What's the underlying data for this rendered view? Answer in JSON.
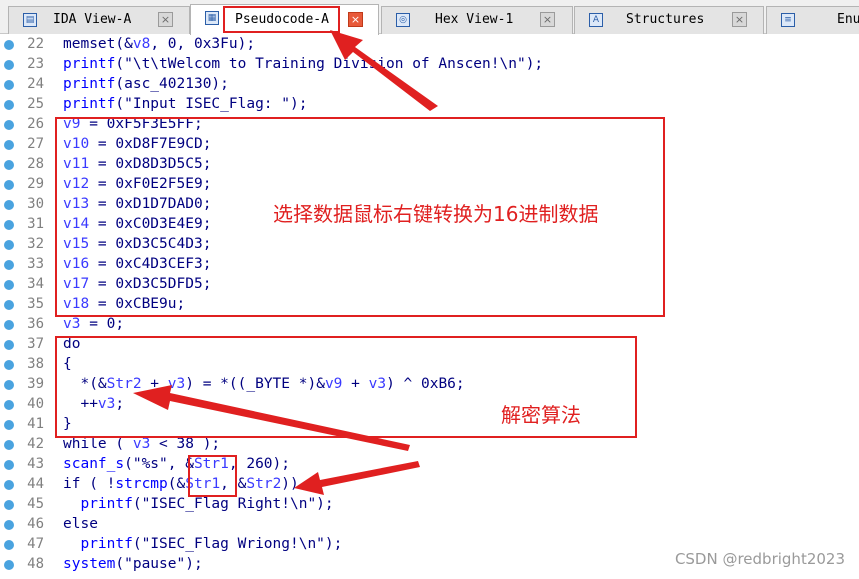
{
  "tabs": [
    {
      "label": "IDA View-A",
      "icon": "ida-view-icon",
      "active": false
    },
    {
      "label": "Pseudocode-A",
      "icon": "pseudocode-icon",
      "active": true
    },
    {
      "label": "Hex View-1",
      "icon": "hex-view-icon",
      "active": false
    },
    {
      "label": "Structures",
      "icon": "structures-icon",
      "active": false
    },
    {
      "label": "Enu",
      "icon": "enums-icon",
      "active": false
    }
  ],
  "code": [
    {
      "n": "22",
      "segs": [
        [
          "",
          "memset(&"
        ],
        [
          "var",
          "v8"
        ],
        [
          "",
          ", 0, 0x3Fu);"
        ]
      ]
    },
    {
      "n": "23",
      "segs": [
        [
          "fn",
          "printf"
        ],
        [
          "",
          "(\"\\t\\tWelcom to Training Division of Anscen!\\n\");"
        ]
      ]
    },
    {
      "n": "24",
      "segs": [
        [
          "fn",
          "printf"
        ],
        [
          "",
          "(asc_402130);"
        ]
      ]
    },
    {
      "n": "25",
      "segs": [
        [
          "fn",
          "printf"
        ],
        [
          "",
          "(\"Input ISEC_Flag: \");"
        ]
      ]
    },
    {
      "n": "26",
      "segs": [
        [
          "var",
          "v9"
        ],
        [
          "",
          " = 0xF5F3E5FF;"
        ]
      ]
    },
    {
      "n": "27",
      "segs": [
        [
          "var",
          "v10"
        ],
        [
          "",
          " = 0xD8F7E9CD;"
        ]
      ]
    },
    {
      "n": "28",
      "segs": [
        [
          "var",
          "v11"
        ],
        [
          "",
          " = 0xD8D3D5C5;"
        ]
      ]
    },
    {
      "n": "29",
      "segs": [
        [
          "var",
          "v12"
        ],
        [
          "",
          " = 0xF0E2F5E9;"
        ]
      ]
    },
    {
      "n": "30",
      "segs": [
        [
          "var",
          "v13"
        ],
        [
          "",
          " = 0xD1D7DAD0;"
        ]
      ]
    },
    {
      "n": "31",
      "segs": [
        [
          "var",
          "v14"
        ],
        [
          "",
          " = 0xC0D3E4E9;"
        ]
      ]
    },
    {
      "n": "32",
      "segs": [
        [
          "var",
          "v15"
        ],
        [
          "",
          " = 0xD3C5C4D3;"
        ]
      ]
    },
    {
      "n": "33",
      "segs": [
        [
          "var",
          "v16"
        ],
        [
          "",
          " = 0xC4D3CEF3;"
        ]
      ]
    },
    {
      "n": "34",
      "segs": [
        [
          "var",
          "v17"
        ],
        [
          "",
          " = 0xD3C5DFD5;"
        ]
      ]
    },
    {
      "n": "35",
      "segs": [
        [
          "var",
          "v18"
        ],
        [
          "",
          " = 0xCBE9u;"
        ]
      ]
    },
    {
      "n": "36",
      "segs": [
        [
          "var",
          "v3"
        ],
        [
          "",
          " = 0;"
        ]
      ]
    },
    {
      "n": "37",
      "segs": [
        [
          "",
          "do"
        ]
      ]
    },
    {
      "n": "38",
      "segs": [
        [
          "",
          "{"
        ]
      ]
    },
    {
      "n": "39",
      "segs": [
        [
          "",
          "  *(&"
        ],
        [
          "var",
          "Str2"
        ],
        [
          "",
          " + "
        ],
        [
          "var",
          "v3"
        ],
        [
          "",
          ") = *((_BYTE *)&"
        ],
        [
          "var",
          "v9"
        ],
        [
          "",
          " + "
        ],
        [
          "var",
          "v3"
        ],
        [
          "",
          ") ^ 0xB6;"
        ]
      ]
    },
    {
      "n": "40",
      "segs": [
        [
          "",
          "  ++"
        ],
        [
          "var",
          "v3"
        ],
        [
          "",
          ";"
        ]
      ]
    },
    {
      "n": "41",
      "segs": [
        [
          "",
          "}"
        ]
      ]
    },
    {
      "n": "42",
      "segs": [
        [
          "",
          "while ( "
        ],
        [
          "var",
          "v3"
        ],
        [
          "",
          " < 38 );"
        ]
      ]
    },
    {
      "n": "43",
      "segs": [
        [
          "fn",
          "scanf_s"
        ],
        [
          "",
          "(\"%s\", &"
        ],
        [
          "var",
          "Str1"
        ],
        [
          "",
          ", 260);"
        ]
      ]
    },
    {
      "n": "44",
      "segs": [
        [
          "",
          "if ( !"
        ],
        [
          "fn",
          "strcmp"
        ],
        [
          "",
          "(&"
        ],
        [
          "var",
          "Str1"
        ],
        [
          "",
          ", &"
        ],
        [
          "var",
          "Str2"
        ],
        [
          "",
          "))"
        ]
      ]
    },
    {
      "n": "45",
      "segs": [
        [
          "",
          "  "
        ],
        [
          "fn",
          "printf"
        ],
        [
          "",
          "(\"ISEC_Flag Right!\\n\");"
        ]
      ]
    },
    {
      "n": "46",
      "segs": [
        [
          "",
          "else"
        ]
      ]
    },
    {
      "n": "47",
      "segs": [
        [
          "",
          "  "
        ],
        [
          "fn",
          "printf"
        ],
        [
          "",
          "(\"ISEC_Flag Wriong!\\n\");"
        ]
      ]
    },
    {
      "n": "48",
      "segs": [
        [
          "fn",
          "system"
        ],
        [
          "",
          "(\"pause\");"
        ]
      ]
    }
  ],
  "annotations": {
    "convert_hex": "选择数据鼠标右键转换为16进制数据",
    "decrypt": "解密算法"
  },
  "watermark": "CSDN @redbright2023",
  "colors": {
    "annotation": "#e02020",
    "keyword_fn": "#0000ff",
    "variable": "#3a3aff",
    "text": "#000080",
    "dot": "#4aa3df"
  }
}
